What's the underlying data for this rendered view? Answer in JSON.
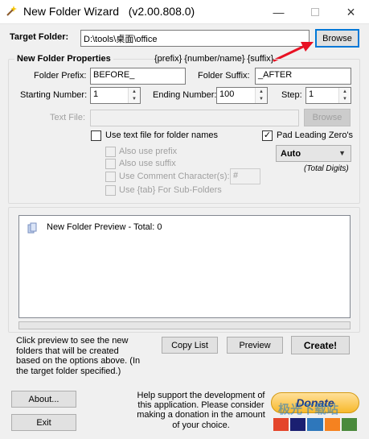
{
  "window": {
    "title": "New Folder Wizard",
    "version": "(v2.00.808.0)",
    "minimize_icon": "minimize-icon",
    "maximize_icon": "maximize-icon",
    "close_icon": "close-icon"
  },
  "target": {
    "label": "Target Folder:",
    "value": "D:\\tools\\桌面\\office",
    "browse_label": "Browse"
  },
  "properties": {
    "group_label": "New Folder Properties",
    "pattern": "{prefix} {number/name} {suffix}",
    "prefix_label": "Folder Prefix:",
    "prefix_value": "BEFORE_",
    "suffix_label": "Folder Suffix:",
    "suffix_value": "_AFTER",
    "start_label": "Starting Number:",
    "start_value": "1",
    "end_label": "Ending Number:",
    "end_value": "100",
    "step_label": "Step:",
    "step_value": "1",
    "textfile_label": "Text File:",
    "textfile_value": "",
    "textfile_browse": "Browse",
    "use_textfile_label": "Use text file for folder names",
    "use_textfile_checked": false,
    "pad_label": "Pad Leading Zero's",
    "pad_checked": true,
    "also_prefix": "Also use prefix",
    "also_suffix": "Also use suffix",
    "comment_char_label": "Use Comment Character(s):",
    "comment_char_value": "#",
    "tab_label": "Use {tab} For Sub-Folders",
    "digits_value": "Auto",
    "digits_caption": "(Total Digits)"
  },
  "preview": {
    "item_text": "New Folder Preview - Total: 0",
    "progress": 0
  },
  "help": {
    "text": "Click preview to see the new folders that will be created based on the options above. (In the target folder specified.)",
    "copy_label": "Copy List",
    "preview_label": "Preview",
    "create_label": "Create!"
  },
  "footer": {
    "about_label": "About...",
    "exit_label": "Exit",
    "donate_text": "Help support the development of this application. Please consider making a donation in the amount of your choice.",
    "donate_button": "Donate",
    "watermark": "极光下载站"
  },
  "colors": {
    "accent": "#0078d7",
    "arrow": "#e81123",
    "donate": "#f7b92c"
  }
}
